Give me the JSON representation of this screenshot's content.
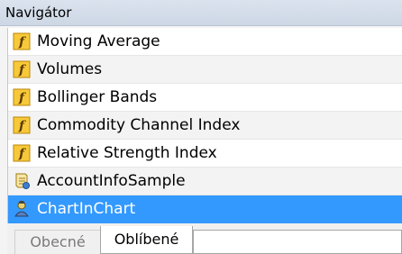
{
  "window": {
    "title": "Navigátor"
  },
  "items": [
    {
      "label": "Moving Average",
      "icon": "function-icon",
      "selected": false
    },
    {
      "label": "Volumes",
      "icon": "function-icon",
      "selected": false
    },
    {
      "label": "Bollinger Bands",
      "icon": "function-icon",
      "selected": false
    },
    {
      "label": "Commodity Channel Index",
      "icon": "function-icon",
      "selected": false
    },
    {
      "label": "Relative Strength Index",
      "icon": "function-icon",
      "selected": false
    },
    {
      "label": "AccountInfoSample",
      "icon": "script-icon",
      "selected": false
    },
    {
      "label": "ChartInChart",
      "icon": "expert-advisor-icon",
      "selected": true
    }
  ],
  "tabs": [
    {
      "label": "Obecné",
      "active": false
    },
    {
      "label": "Oblíbené",
      "active": true
    }
  ],
  "colors": {
    "selection": "#3399ff",
    "function_icon": "#f5c400"
  }
}
